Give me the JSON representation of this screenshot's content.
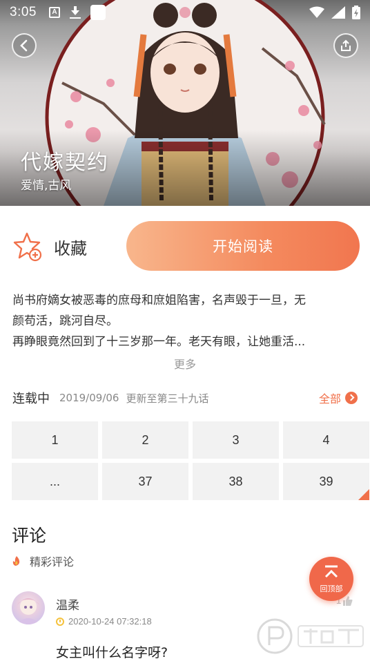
{
  "status_bar": {
    "time": "3:05",
    "icons": [
      "a-notification-icon",
      "download-icon",
      "app-icon",
      "wifi-icon",
      "signal-icon",
      "battery-icon"
    ]
  },
  "header": {
    "back_icon": "chevron-left-icon",
    "share_icon": "share-icon"
  },
  "comic": {
    "title": "代嫁契约",
    "tags": "爱情,古风"
  },
  "actions": {
    "favorite_label": "收藏",
    "read_label": "开始阅读"
  },
  "synopsis": {
    "lines": [
      "尚书府嫡女被恶毒的庶母和庶姐陷害，名声毁于一旦，无",
      "颜苟活，跳河自尽。",
      "再睁眼竟然回到了十三岁那一年。老天有眼，让她重活..."
    ],
    "more_label": "更多"
  },
  "chapters": {
    "status": "连载中",
    "date": "2019/09/06",
    "update_text": "更新至第三十九话",
    "all_label": "全部",
    "items": [
      "1",
      "2",
      "3",
      "4",
      "...",
      "37",
      "38",
      "39"
    ]
  },
  "comments": {
    "title": "评论",
    "hot_label": "精彩评论",
    "items": [
      {
        "user": "温柔",
        "time": "2020-10-24 07:32:18",
        "text": "女主叫什么名字呀?",
        "likes": "1"
      }
    ]
  },
  "back_to_top": {
    "label": "回顶部"
  },
  "colors": {
    "accent": "#f0704a",
    "button_gradient_start": "#f8b68c",
    "button_gradient_end": "#f1764f"
  }
}
